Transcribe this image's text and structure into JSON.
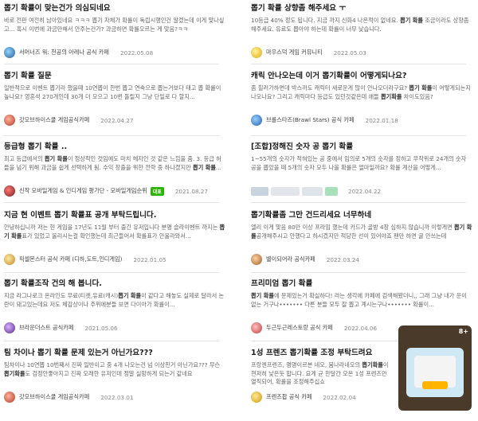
{
  "left": [
    {
      "title": "뽑기 확률이 맞는건가 의심되네요",
      "snippet": "바로 전판 여전히 남아있네요 ㅋㅋㅋ 뽑기 자체가 확률이 독립시행인건 알겠는데 이게 맞나싶고... 혹시 이번에 과금만해서 안주는건가? 과금하면 확률오르는 게 맞음?ㅋㅋ",
      "source": "서머너즈 워: 천공의 아레나 공식 카페",
      "date": "2022.05.08"
    },
    {
      "title": "뽑기 확률 질문",
      "snippet": "일반적으로 이벤트 뽑기라 했을때 10연뽑이 한번 뽑고 연속으로 뽑는거보다 태고 뽑 확률이 높나요? 영혼석 270개인데 30개 더 모으고 10번 돌릴지 그냥 단일로 다 할지...",
      "source": "갓오브하이스쿨 게임공식카페",
      "date": "2022.04.27"
    },
    {
      "title": "등급형 뽑기 확률 ..",
      "snippet": "최고 등급에서의 뽑기 확률이 정상적인 것임에도 마치 헤자인 것 같은 느낌을 줌. 3. 등급 허들을 넘기 위해 과금을 쉽게 선택하게 됨. 수익 창출을 위한 전략 중 하나겠지만 뽑기 확률...",
      "source": "신작 모바일게임 & 인디게임 평가단 - 모바일게임순위",
      "badge": "대표",
      "date": "2021.08.27"
    },
    {
      "title": "지금 현 이벤트 뽑기 확률표 공개 부탁드립니다.",
      "snippet": "안녕하십니까 저는 현 게임을 17년도 11월 부터 즐긴 유저입니다 분명 슬라이벤트 까지는 뽑기 확률표가 있었고 올리시는걸 확인했는데 최근들어서 확률표가 안올라와서...",
      "source": "픽셀몬스터 공식 카페 (디하,도트,인디게임)",
      "date": "2022.01.05"
    },
    {
      "title": "뽑기 확률조작 건의 해 봅니다.",
      "snippet": "지금 라그나로크 온라인도 무료(티켓,유료(캐시)뽑기 확률이 같다고 해놓도 실제로 달라서 논란이 돼고있는데요 저도 체감상이나 주위에분들 보면 다이아가 확률이...",
      "source": "브라운더스트 공식카페",
      "date": "2021.05.06"
    },
    {
      "title": "팀 차이나 뽑기 확률 문제 있는거 아닌가요???",
      "snippet": "팀차이나 10연뽑 10번째서 진짜 일반이고 중 4개 나오는건 넘 이상한거 아닌가요??? 무슨 뽑기확률도 검정안좋아지고 진짜 오래한 유저인데 정말 실망하게 되는거 같네요",
      "source": "갓오브하이스쿨 게임공식카페",
      "date": "2022.03.01"
    }
  ],
  "right": [
    {
      "title": "뽑기 확률 상향좀 해주세요 ㅜ",
      "snippet": "10등급 40% 정도 됩니다. 지금 까지 신화4 나온적이 없네요. 뽑기 확률 조금이라도 상향좀 해주세요. 유료도 뽑아야 하는데 확률이 너무 낮습니다.",
      "source": "마우스덕 게임 커뮤니티",
      "date": "2022.05.03"
    },
    {
      "title": "캐릭 안나오는데 이거 뽑기확률이 어떻게되나요?",
      "snippet": "좀 힐러가하면데 박스까도 캐릭터 새로운게 많이 안나오더라구요? 뽑기 확률이 어떻게되는지 나오나요? 그리고 캐릭마다 등급도 있던것같은데 애들 뽑기확률 차이도있음?",
      "source": "브롤스타즈(Brawl Stars) 공식 카페",
      "date": "2022.01.18"
    },
    {
      "title": "[조합]정해진 숫자 공 뽑기 확률",
      "snippet": "1~55개의 숫자가 적혀있는 공 중에서 임의로 5개의 숫자를 정하고 무작위로 24개의 숫자 공을 뽑았을 때 5개의 숫자 모두 나올 확률은 얼마일까요? 확률 계산을 어떻게...",
      "source": "",
      "date": "2022.04.22"
    },
    {
      "title": "뽑기확률좀 그만 건드리세요 너무하네",
      "snippet": "엘리 이게 맞음 80만 이상 프라임 했는데 카드가 골방 4장 심하지 않습니까 이렇게면 뽑기 확률공개해주시고 안했다고 하시겠지만 적당한 선이 있어야죠 팬만 하면 귤 안쓰는데",
      "source": "별이되어라 공식카페",
      "date": "2022.03.24"
    },
    {
      "title": "프리미엄 뽑기 확률",
      "snippet": "뽑기 확률에 문제있는거 확실하다! 라는 생각에 카페에 검색해봤더니,, 그래 그냥 내가 운이 없는 거구나••••••• 다른 분들 모두 잘 뽑고 계시는구나••••••• 확률이...",
      "source": "두근두근레스토랑 공식 카페",
      "date": "2022.04.06"
    },
    {
      "title": "1성 프렌즈 뽑기확률 조정 부탁드려요",
      "snippet": "프랑켄프렌즈, 명명이르본 네오, 뭄나라네오의 뽑기확률이 현저히 낮은듯 합니다. 요게 균 한달간 오온 1성 프렌즈만 열직되어, 확률을 조정해주십쇼",
      "source": "프렌즈팝 공식 카페",
      "date": "2022.02.04"
    }
  ],
  "thumb_tag": "8+",
  "colors": {
    "accent": "#2db400",
    "separator": "#e5e5e5"
  }
}
